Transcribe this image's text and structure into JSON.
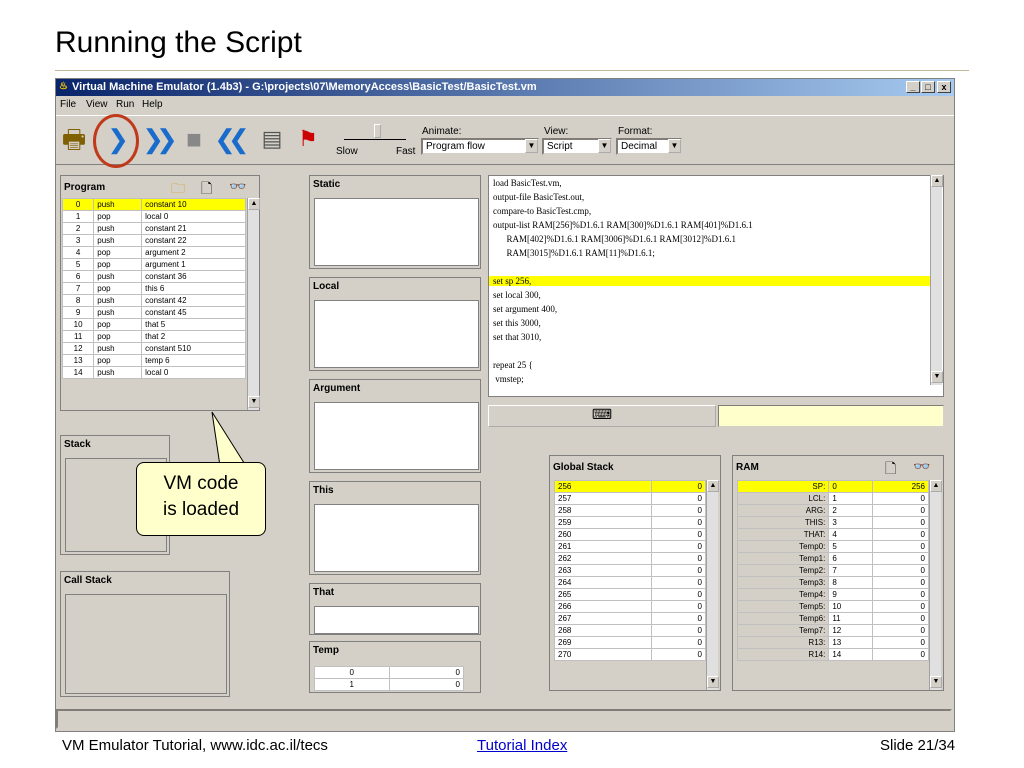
{
  "slide": {
    "title": "Running the Script",
    "footer_left": "VM Emulator Tutorial, www.idc.ac.il/tecs",
    "footer_link": "Tutorial Index",
    "footer_right": "Slide 21/34"
  },
  "window": {
    "title": "Virtual Machine Emulator (1.4b3) - G:\\projects\\07\\MemoryAccess\\BasicTest/BasicTest.vm",
    "min": "_",
    "max": "□",
    "close": "x"
  },
  "menu": [
    "File",
    "View",
    "Run",
    "Help"
  ],
  "toolbar": {
    "animate_label": "Animate:",
    "animate_value": "Program flow",
    "view_label": "View:",
    "view_value": "Script",
    "format_label": "Format:",
    "format_value": "Decimal",
    "slow": "Slow",
    "fast": "Fast"
  },
  "program": {
    "title": "Program",
    "rows": [
      [
        "0",
        "push",
        "constant 10"
      ],
      [
        "1",
        "pop",
        "local 0"
      ],
      [
        "2",
        "push",
        "constant 21"
      ],
      [
        "3",
        "push",
        "constant 22"
      ],
      [
        "4",
        "pop",
        "argument 2"
      ],
      [
        "5",
        "pop",
        "argument 1"
      ],
      [
        "6",
        "push",
        "constant 36"
      ],
      [
        "7",
        "pop",
        "this 6"
      ],
      [
        "8",
        "push",
        "constant 42"
      ],
      [
        "9",
        "push",
        "constant 45"
      ],
      [
        "10",
        "pop",
        "that 5"
      ],
      [
        "11",
        "pop",
        "that 2"
      ],
      [
        "12",
        "push",
        "constant 510"
      ],
      [
        "13",
        "pop",
        "temp 6"
      ],
      [
        "14",
        "push",
        "local 0"
      ]
    ]
  },
  "panels": {
    "stack": "Stack",
    "call_stack": "Call Stack",
    "static": "Static",
    "local": "Local",
    "argument": "Argument",
    "this": "This",
    "that": "That",
    "temp": "Temp"
  },
  "temp_rows": [
    [
      "0",
      "0"
    ],
    [
      "1",
      "0"
    ]
  ],
  "script": {
    "lines": [
      "load BasicTest.vm,",
      "output-file BasicTest.out,",
      "compare-to BasicTest.cmp,",
      "output-list RAM[256]%D1.6.1 RAM[300]%D1.6.1 RAM[401]%D1.6.1",
      "      RAM[402]%D1.6.1 RAM[3006]%D1.6.1 RAM[3012]%D1.6.1",
      "      RAM[3015]%D1.6.1 RAM[11]%D1.6.1;",
      "",
      "set sp 256,",
      "set local 300,",
      "set argument 400,",
      "set this 3000,",
      "set that 3010,",
      "",
      "repeat 25 {",
      " vmstep;"
    ]
  },
  "global_stack": {
    "title": "Global Stack",
    "rows": [
      [
        "256",
        "0"
      ],
      [
        "257",
        "0"
      ],
      [
        "258",
        "0"
      ],
      [
        "259",
        "0"
      ],
      [
        "260",
        "0"
      ],
      [
        "261",
        "0"
      ],
      [
        "262",
        "0"
      ],
      [
        "263",
        "0"
      ],
      [
        "264",
        "0"
      ],
      [
        "265",
        "0"
      ],
      [
        "266",
        "0"
      ],
      [
        "267",
        "0"
      ],
      [
        "268",
        "0"
      ],
      [
        "269",
        "0"
      ],
      [
        "270",
        "0"
      ]
    ]
  },
  "ram": {
    "title": "RAM",
    "rows": [
      [
        "SP:",
        "0",
        "256"
      ],
      [
        "LCL:",
        "1",
        "0"
      ],
      [
        "ARG:",
        "2",
        "0"
      ],
      [
        "THIS:",
        "3",
        "0"
      ],
      [
        "THAT:",
        "4",
        "0"
      ],
      [
        "Temp0:",
        "5",
        "0"
      ],
      [
        "Temp1:",
        "6",
        "0"
      ],
      [
        "Temp2:",
        "7",
        "0"
      ],
      [
        "Temp3:",
        "8",
        "0"
      ],
      [
        "Temp4:",
        "9",
        "0"
      ],
      [
        "Temp5:",
        "10",
        "0"
      ],
      [
        "Temp6:",
        "11",
        "0"
      ],
      [
        "Temp7:",
        "12",
        "0"
      ],
      [
        "R13:",
        "13",
        "0"
      ],
      [
        "R14:",
        "14",
        "0"
      ]
    ]
  },
  "callout": {
    "line1": "VM code",
    "line2": "is loaded"
  }
}
